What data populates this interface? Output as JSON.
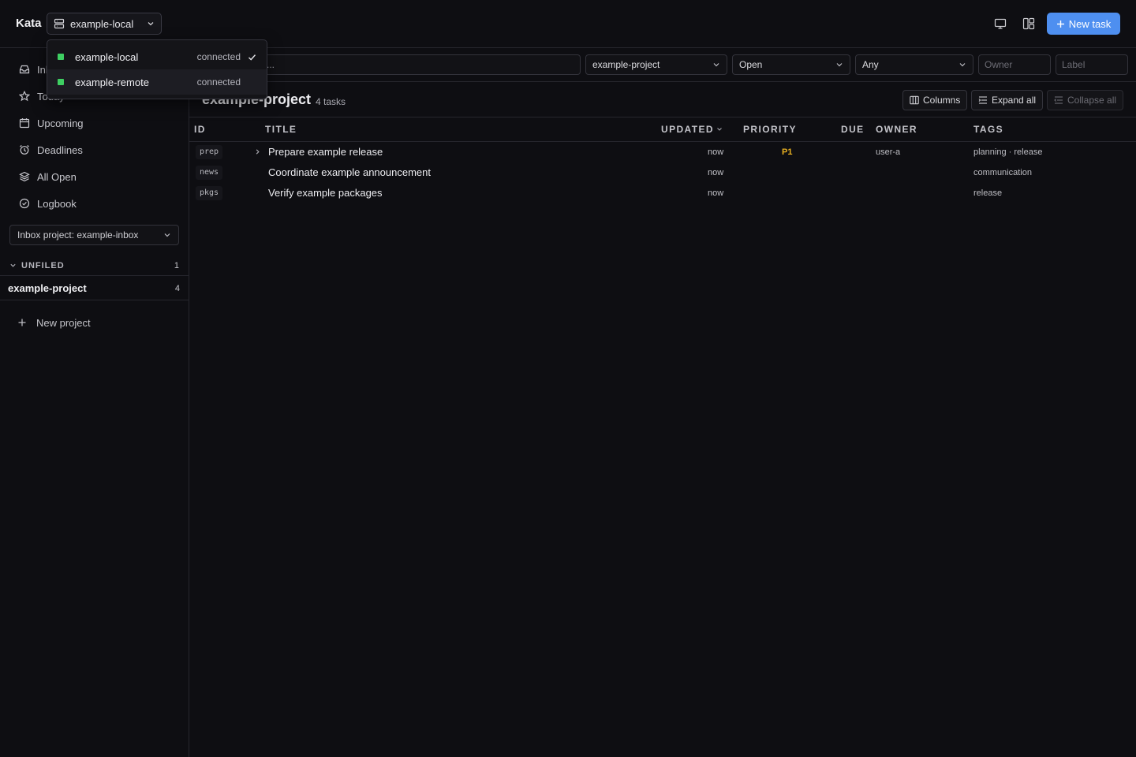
{
  "app": {
    "title": "Kata",
    "server": "example-local",
    "new_task_label": "New task",
    "icons": {
      "server": "server-icon",
      "monitor": "monitor-icon",
      "layout": "layout-icon",
      "plus": "plus-icon"
    }
  },
  "server_menu": {
    "items": [
      {
        "name": "example-local",
        "status": "connected",
        "selected": true,
        "status_color": "#3ecf62"
      },
      {
        "name": "example-remote",
        "status": "connected",
        "selected": false,
        "status_color": "#3ecf62"
      }
    ]
  },
  "sidebar": {
    "nav": [
      {
        "label": "Inbox",
        "icon": "inbox-icon"
      },
      {
        "label": "Today",
        "icon": "star-icon"
      },
      {
        "label": "Upcoming",
        "icon": "calendar-icon"
      },
      {
        "label": "Deadlines",
        "icon": "alarm-clock-icon"
      },
      {
        "label": "All Open",
        "icon": "layers-icon"
      },
      {
        "label": "Logbook",
        "icon": "check-circle-icon"
      }
    ],
    "inbox_project_label": "Inbox project: example-inbox",
    "groups": [
      {
        "label": "UNFILED",
        "count": "1"
      }
    ],
    "projects": [
      {
        "label": "example-project",
        "count": "4"
      }
    ],
    "new_project_label": "New project"
  },
  "filters": {
    "search_placeholder": "...",
    "project": "example-project",
    "status": "Open",
    "priority": "Any",
    "owner_placeholder": "Owner",
    "label_placeholder": "Label"
  },
  "project": {
    "title": "example-project",
    "count_label": "4 tasks",
    "columns_label": "Columns",
    "expand_label": "Expand all",
    "collapse_label": "Collapse all"
  },
  "table": {
    "columns": [
      "ID",
      "TITLE",
      "UPDATED",
      "PRIORITY",
      "DUE",
      "OWNER",
      "TAGS"
    ],
    "rows": [
      {
        "id": "prep",
        "title": "Prepare example release",
        "updated": "now",
        "priority": "P1",
        "due": "",
        "owner": "user-a",
        "tags": "planning · release",
        "has_children": true
      },
      {
        "id": "news",
        "title": "Coordinate example announcement",
        "updated": "now",
        "priority": "",
        "due": "",
        "owner": "",
        "tags": "communication",
        "has_children": false
      },
      {
        "id": "pkgs",
        "title": "Verify example packages",
        "updated": "now",
        "priority": "",
        "due": "",
        "owner": "",
        "tags": "release",
        "has_children": false
      }
    ]
  },
  "colors": {
    "accent": "#4e8ff0",
    "priority_p1": "#e9b121",
    "status_connected": "#3ecf62",
    "background": "#0e0e12"
  }
}
